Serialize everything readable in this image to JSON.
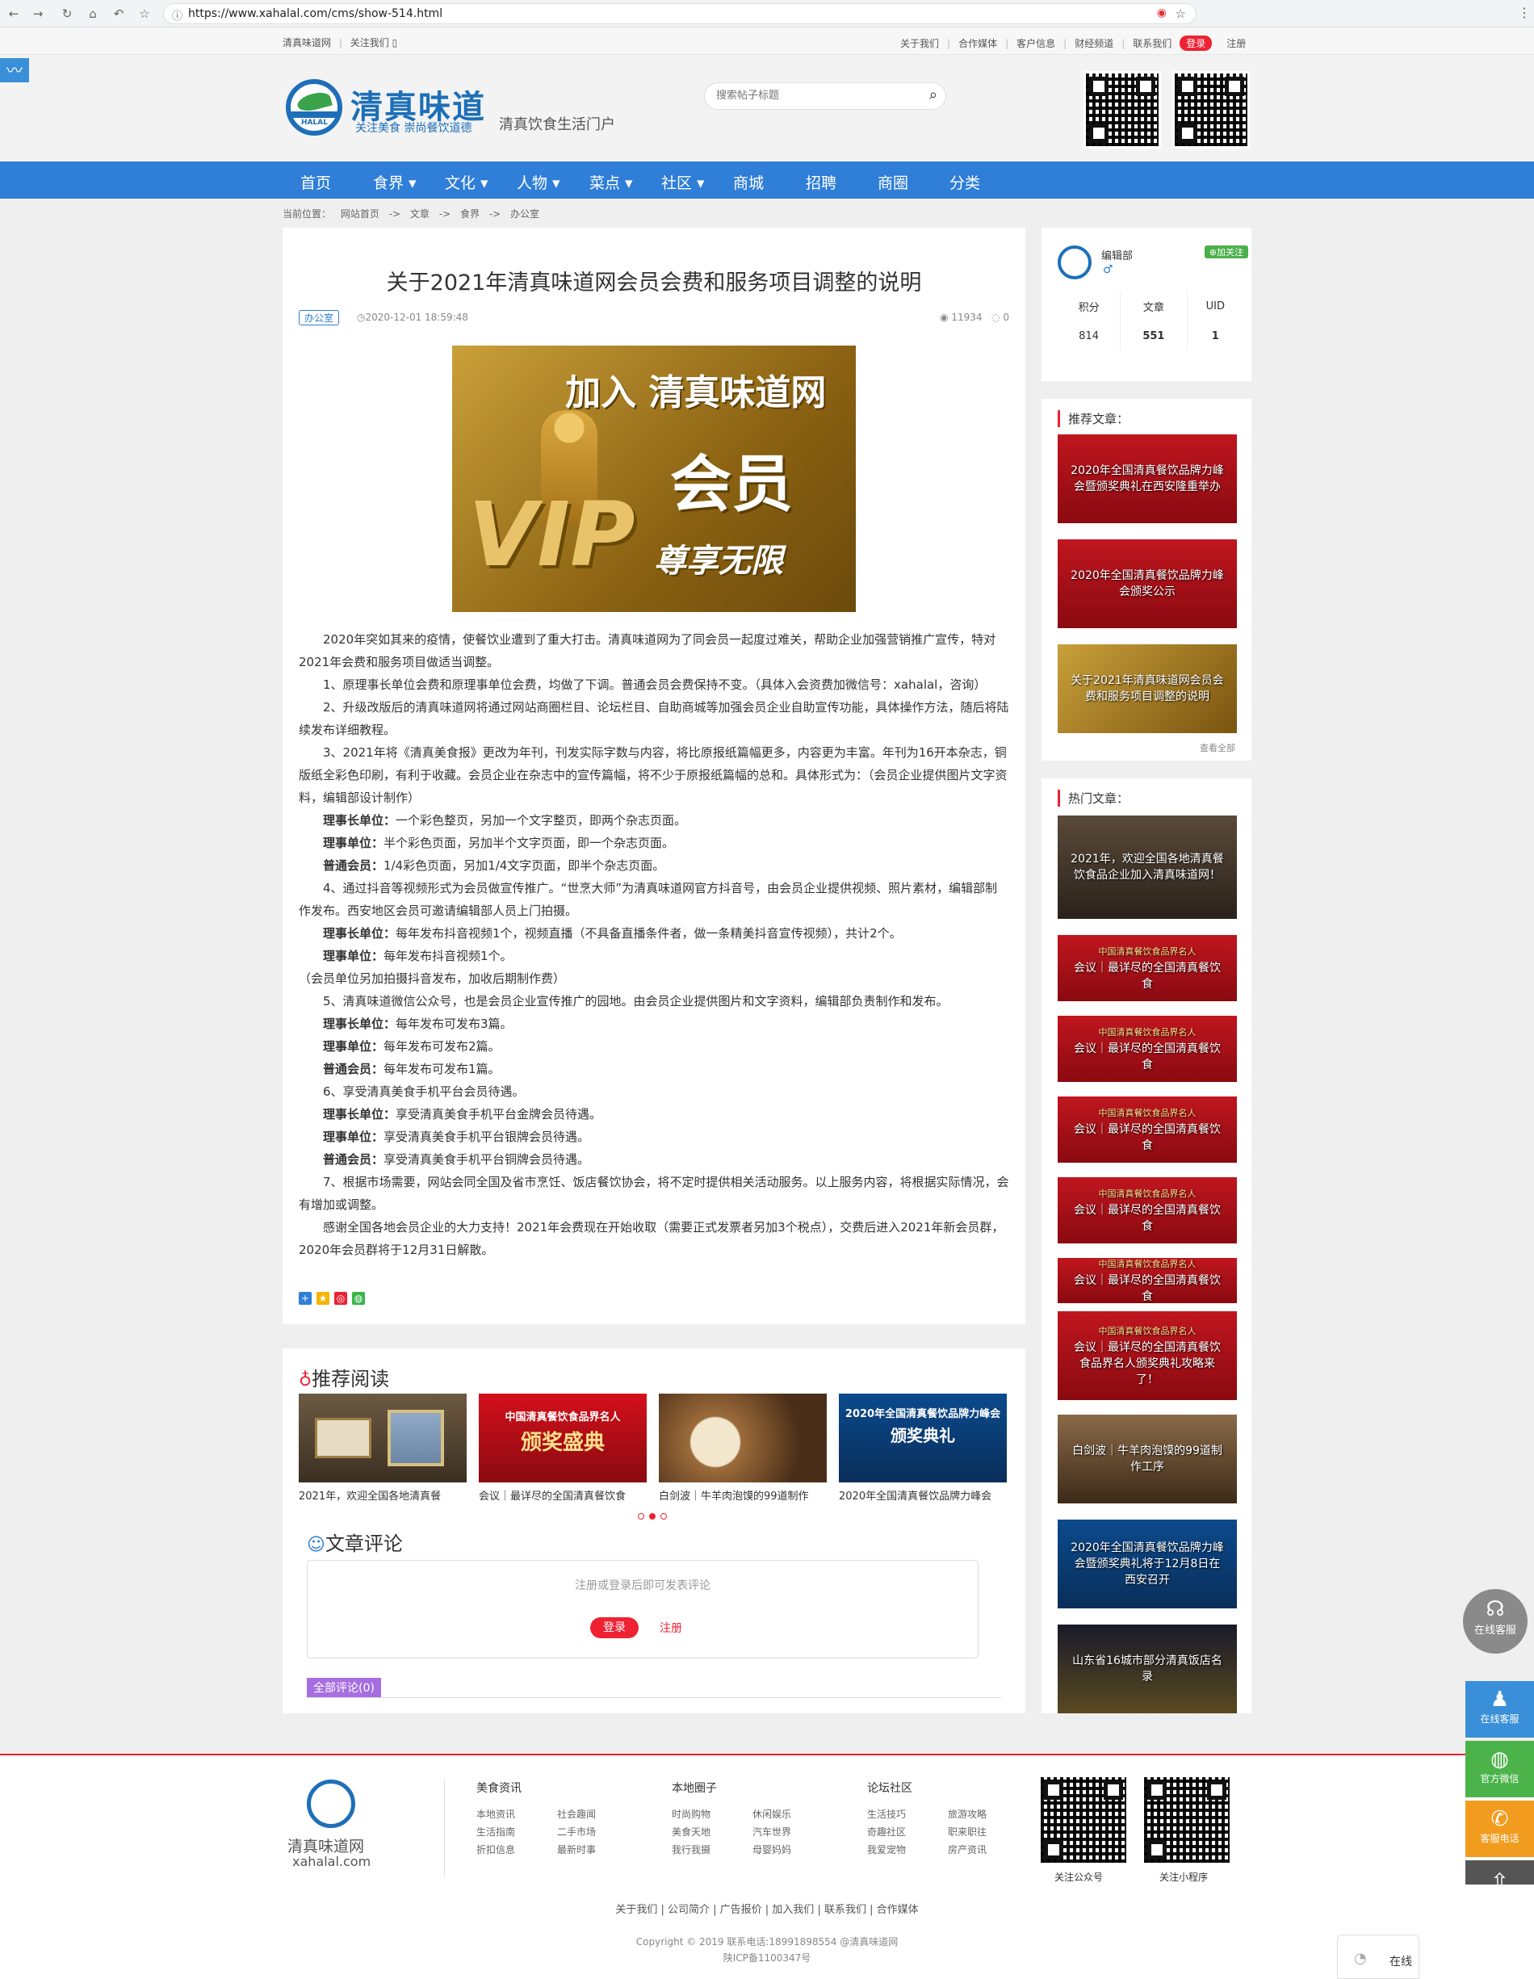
{
  "browser": {
    "url": "https://www.xahalal.com/cms/show-514.html"
  },
  "topbar": {
    "left": [
      "清真味道网",
      "关注我们"
    ],
    "right": [
      "关于我们",
      "合作媒体",
      "客户信息",
      "财经频道",
      "联系我们"
    ],
    "login": "登录",
    "register": "注册"
  },
  "header": {
    "brand": "清真味道",
    "slogan": "关注美食 崇尚餐饮道德",
    "logo_text": "HALAL",
    "portal": "清真饮食生活门户",
    "search_placeholder": "搜索帖子标题"
  },
  "nav": [
    "首页",
    "食界 ▾",
    "文化 ▾",
    "人物 ▾",
    "菜点 ▾",
    "社区 ▾",
    "商城",
    "招聘",
    "商圈",
    "分类"
  ],
  "breadcrumb": [
    "当前位置：",
    "网站首页",
    "->",
    "文章",
    "->",
    "食界",
    "->",
    "办公室"
  ],
  "article": {
    "title": "关于2021年清真味道网会员会费和服务项目调整的说明",
    "tag": "办公室",
    "date": "2020-12-01 18:59:48",
    "views": "11934",
    "comments": "0",
    "banner": {
      "line1": "加入 清真味道网",
      "line2": "会员",
      "line3": "尊享无限",
      "vip": "VIP"
    },
    "paragraphs": [
      {
        "b": "",
        "t": "　　2020年突如其来的疫情，使餐饮业遭到了重大打击。清真味道网为了同会员一起度过难关，帮助企业加强营销推广宣传，特对2021年会费和服务项目做适当调整。"
      },
      {
        "b": "",
        "t": "　　1、原理事长单位会费和原理事单位会费，均做了下调。普通会员会费保持不变。（具体入会资费加微信号：xahalal，咨询）"
      },
      {
        "b": "",
        "t": "　　2、升级改版后的清真味道网将通过网站商圈栏目、论坛栏目、自助商城等加强会员企业自助宣传功能，具体操作方法，随后将陆续发布详细教程。"
      },
      {
        "b": "",
        "t": "　　3、2021年将《清真美食报》更改为年刊，刊发实际字数与内容，将比原报纸篇幅更多，内容更为丰富。年刊为16开本杂志，铜版纸全彩色印刷，有利于收藏。会员企业在杂志中的宣传篇幅，将不少于原报纸篇幅的总和。具体形式为：（会员企业提供图片文字资料，编辑部设计制作）"
      },
      {
        "b": "　　理事长单位：",
        "t": "一个彩色整页，另加一个文字整页，即两个杂志页面。"
      },
      {
        "b": "　　理事单位：",
        "t": "半个彩色页面，另加半个文字页面，即一个杂志页面。"
      },
      {
        "b": "　　普通会员：",
        "t": "1/4彩色页面，另加1/4文字页面，即半个杂志页面。"
      },
      {
        "b": "",
        "t": "　　4、通过抖音等视频形式为会员做宣传推广。“世烹大师”为清真味道网官方抖音号，由会员企业提供视频、照片素材，编辑部制作发布。西安地区会员可邀请编辑部人员上门拍摄。"
      },
      {
        "b": "　　理事长单位：",
        "t": "每年发布抖音视频1个，视频直播（不具备直播条件者，做一条精美抖音宣传视频），共计2个。"
      },
      {
        "b": "　　理事单位：",
        "t": "每年发布抖音视频1个。"
      },
      {
        "b": "",
        "t": "（会员单位另加拍摄抖音发布，加收后期制作费）"
      },
      {
        "b": "",
        "t": "　　5、清真味道微信公众号，也是会员企业宣传推广的园地。由会员企业提供图片和文字资料，编辑部负责制作和发布。"
      },
      {
        "b": "　　理事长单位：",
        "t": "每年发布可发布3篇。"
      },
      {
        "b": "　　理事单位：",
        "t": "每年发布可发布2篇。"
      },
      {
        "b": "　　普通会员：",
        "t": "每年发布可发布1篇。"
      },
      {
        "b": "",
        "t": "　　6、享受清真美食手机平台会员待遇。"
      },
      {
        "b": "　　理事长单位：",
        "t": "享受清真美食手机平台金牌会员待遇。"
      },
      {
        "b": "　　理事单位：",
        "t": "享受清真美食手机平台银牌会员待遇。"
      },
      {
        "b": "　　普通会员：",
        "t": "享受清真美食手机平台铜牌会员待遇。"
      },
      {
        "b": "",
        "t": "　　7、根据市场需要，网站会同全国及省市烹饪、饭店餐饮协会，将不定时提供相关活动服务。以上服务内容，将根据实际情况，会有增加或调整。"
      },
      {
        "b": "",
        "t": "　　感谢全国各地会员企业的大力支持！2021年会费现在开始收取（需要正式发票者另加3个税点），交费后进入2021年新会员群，2020年会员群将于12月31日解散。"
      }
    ]
  },
  "author": {
    "name": "编辑部",
    "sex": "♂",
    "follow": "加关注",
    "stats_labels": [
      "积分",
      "文章",
      "UID"
    ],
    "stats_values": [
      "814",
      "551",
      "1"
    ]
  },
  "recommended": {
    "title": "推荐文章：",
    "items": [
      "2020年全国清真餐饮品牌力峰会暨颁奖典礼在西安隆重举办",
      "2020年全国清真餐饮品牌力峰会颁奖公示",
      "关于2021年清真味道网会员会费和服务项目调整的说明"
    ],
    "more": "查看全部"
  },
  "hot": {
    "title": "热门文章：",
    "items": [
      "2021年，欢迎全国各地清真餐饮食品企业加入清真味道网！",
      "会议｜最详尽的全国清真餐饮食",
      "会议｜最详尽的全国清真餐饮食",
      "会议｜最详尽的全国清真餐饮食",
      "会议｜最详尽的全国清真餐饮食",
      "会议｜最详尽的全国清真餐饮食",
      "会议｜最详尽的全国清真餐饮食品界名人颁奖典礼攻略来了！",
      "白剑波｜牛羊肉泡馍的99道制作工序",
      "2020年全国清真餐饮品牌力峰会暨颁奖典礼将于12月8日在西安召开",
      "山东省16城市部分清真饭店名录"
    ],
    "red_sub": "中国清真餐饮食品界名人"
  },
  "reading": {
    "title": "推荐阅读",
    "captions": [
      "2021年，欢迎全国各地清真餐",
      "会议｜最详尽的全国清真餐饮食",
      "白剑波｜牛羊肉泡馍的99道制作",
      "2020年全国清真餐饮品牌力峰会"
    ],
    "item2_text": "中国清真餐饮食品界名人",
    "item2_big": "颁奖盛典",
    "item4_text": "2020年全国清真餐饮品牌力峰会",
    "item4_big": "颁奖典礼"
  },
  "comments": {
    "title": "文章评论",
    "hint": "注册或登录后即可发表评论",
    "login": "登录",
    "register": "注册",
    "all": "全部评论(0)"
  },
  "footer": {
    "site_name": "清真味道网",
    "site_domain": "xahalal.com",
    "col1_title": "美食资讯",
    "col1": [
      "本地资讯",
      "社会趣闻",
      "生活指南",
      "二手市场",
      "折扣信息",
      "最新时事"
    ],
    "col2_title": "本地圈子",
    "col2": [
      "时尚购物",
      "休闲娱乐",
      "美食天地",
      "汽车世界",
      "我行我摄",
      "母婴妈妈"
    ],
    "col3_title": "论坛社区",
    "col3": [
      "生活技巧",
      "旅游攻略",
      "奇趣社区",
      "职来职往",
      "我爱宠物",
      "房产资讯"
    ],
    "qr1": "关注公众号",
    "qr2": "关注小程序",
    "links": "关于我们 | 公司简介 | 广告报价 | 加入我们 | 联系我们 | 合作媒体",
    "copyright": "Copyright © 2019 联系电话:18991898554 @清真味道网",
    "icp": "陕ICP备1100347号"
  },
  "float": {
    "service": "在线客服",
    "online": "在线客服",
    "wechat": "官方微信",
    "phone": "客服电话",
    "chat": "在线"
  },
  "colors": {
    "nav": "#2f7ed8",
    "accent_red": "#e22233",
    "brand_blue": "#1d6fb8"
  }
}
